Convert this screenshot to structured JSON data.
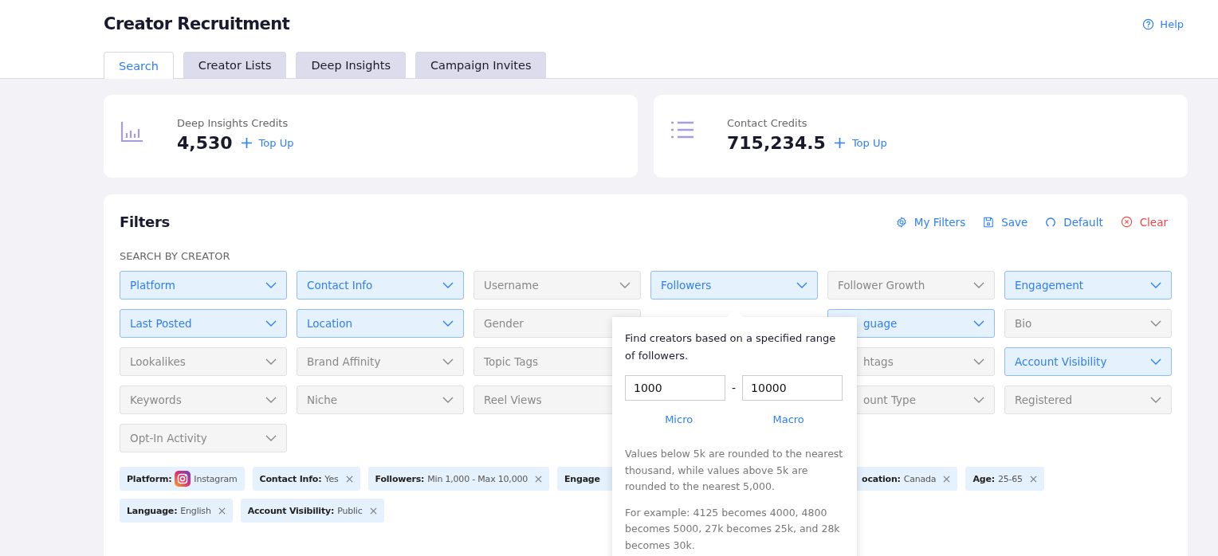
{
  "header": {
    "title": "Creator Recruitment",
    "help": "Help"
  },
  "tabs": [
    {
      "label": "Search",
      "selected": true
    },
    {
      "label": "Creator Lists",
      "selected": false
    },
    {
      "label": "Deep Insights",
      "selected": false
    },
    {
      "label": "Campaign Invites",
      "selected": false
    }
  ],
  "credits": [
    {
      "kind": "chart",
      "label": "Deep Insights Credits",
      "value": "4,530",
      "action": "Top Up"
    },
    {
      "kind": "list",
      "label": "Contact Credits",
      "value": "715,234.5",
      "action": "Top Up"
    }
  ],
  "filters": {
    "title": "Filters",
    "actions": [
      {
        "kind": "settings",
        "label": "My Filters"
      },
      {
        "kind": "save",
        "label": "Save"
      },
      {
        "kind": "reset",
        "label": "Default"
      },
      {
        "kind": "clear",
        "label": "Clear"
      }
    ],
    "section_label": "SEARCH BY CREATOR",
    "field_rows": [
      [
        {
          "label": "Platform",
          "active": true
        },
        {
          "label": "Contact Info",
          "active": true
        },
        {
          "label": "Username",
          "active": false
        },
        {
          "label": "Followers",
          "active": true
        },
        {
          "label": "Follower Growth",
          "active": false
        },
        {
          "label": "Engagement",
          "active": true
        }
      ],
      [
        {
          "label": "Last Posted",
          "active": true
        },
        {
          "label": "Location",
          "active": true
        },
        {
          "label": "Gender",
          "active": false
        },
        {
          "label": "guage",
          "active": true,
          "cut": true
        },
        {
          "label": "Bio",
          "active": false
        }
      ],
      [
        {
          "label": "Lookalikes",
          "active": false
        },
        {
          "label": "Brand Affinity",
          "active": false
        },
        {
          "label": "Topic Tags",
          "active": false
        },
        {
          "label": "htags",
          "active": false,
          "cut": true
        },
        {
          "label": "Account Visibility",
          "active": true
        }
      ],
      [
        {
          "label": "Keywords",
          "active": false
        },
        {
          "label": "Niche",
          "active": false
        },
        {
          "label": "Reel Views",
          "active": false
        },
        {
          "label": "ount Type",
          "active": false,
          "cut": true
        },
        {
          "label": "Registered",
          "active": false
        }
      ],
      [
        {
          "label": "Opt-In Activity",
          "active": false
        }
      ]
    ],
    "chip_rows": [
      [
        {
          "kind": "platform",
          "label": "Platform:",
          "value": "Instagram",
          "removable": false
        },
        {
          "kind": "filter",
          "label": "Contact Info:",
          "value": "Yes",
          "removable": true
        },
        {
          "kind": "filter",
          "label": "Followers:",
          "value": "Min 1,000 - Max 10,000",
          "removable": true
        },
        {
          "kind": "filter",
          "label": "Engage",
          "removable": false,
          "clipped_end": true
        },
        {
          "kind": "filter",
          "label": "ocation:",
          "value": "Canada",
          "removable": true,
          "clipped_start": true
        },
        {
          "kind": "filter",
          "label": "Age:",
          "value": "25-65",
          "removable": true
        }
      ],
      [
        {
          "kind": "filter",
          "label": "Language:",
          "value": "English",
          "removable": true
        },
        {
          "kind": "filter",
          "label": "Account Visibility:",
          "value": "Public",
          "removable": true
        }
      ]
    ]
  },
  "popover": {
    "text": "Find creators based on a specified range of followers.",
    "min": "1000",
    "separator": "-",
    "max": "10000",
    "presets": [
      "Micro",
      "Macro"
    ],
    "notes": [
      "Values below 5k are rounded to the nearest thousand, while values above 5k are rounded to the nearest 5,000.",
      "For example: 4125 becomes 4000, 4800 becomes 5000, 27k becomes 25k, and 28k becomes 30k."
    ]
  }
}
